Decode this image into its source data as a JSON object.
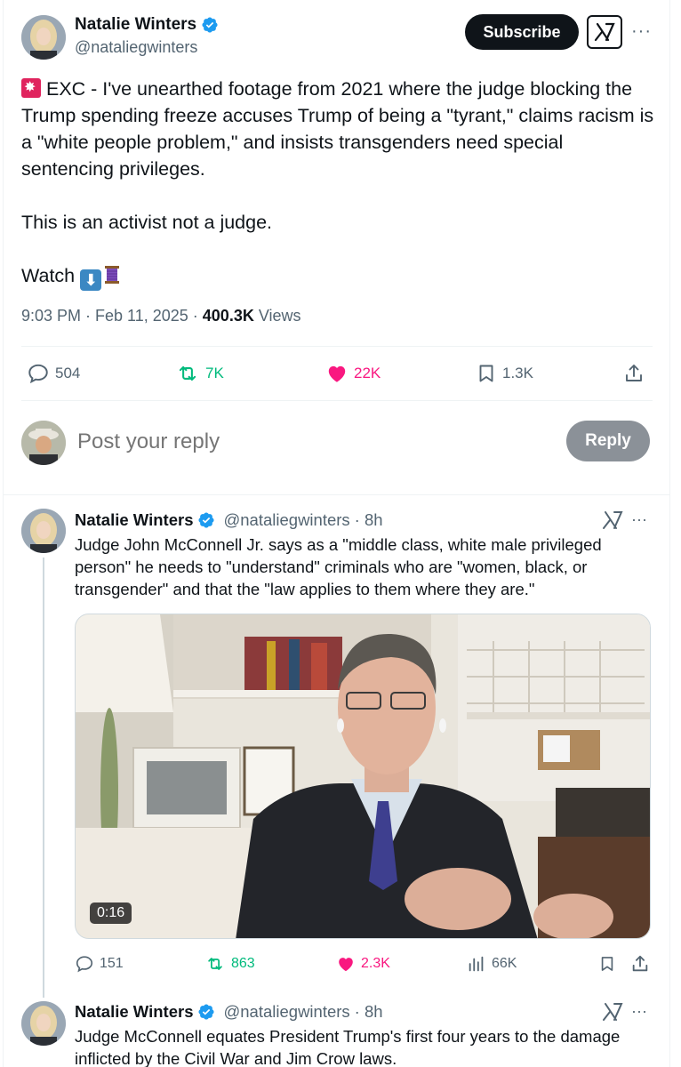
{
  "main_tweet": {
    "author_name": "Natalie Winters",
    "author_handle": "@nataliegwinters",
    "subscribe_label": "Subscribe",
    "more_label": "···",
    "paragraph1": " EXC - I've unearthed footage from 2021 where the  judge blocking the Trump spending freeze accuses Trump of being a \"tyrant,\" claims racism is a \"white people problem,\" and insists transgenders need special sentencing privileges.",
    "paragraph2": "This is an activist not a judge.",
    "paragraph3": "Watch ",
    "time": "9:03 PM · Feb 11, 2025 · ",
    "views_count": "400.3K",
    "views_label": " Views",
    "actions": {
      "replies": "504",
      "reposts": "7K",
      "likes": "22K",
      "bookmarks": "1.3K"
    },
    "colors": {
      "repost": "#00ba7c",
      "like": "#f91880",
      "verified": "#1d9bf0"
    }
  },
  "reply_box": {
    "placeholder": "Post your reply",
    "reply_label": "Reply"
  },
  "thread": [
    {
      "author_name": "Natalie Winters",
      "author_handle": "@nataliegwinters",
      "age": " · 8h",
      "more_label": "···",
      "text": "Judge John McConnell Jr. says as a \"middle class, white male privileged person\" he needs to \"understand\" criminals who are \"women, black, or transgender\" and that the \"law applies to them where they are.\"",
      "video_duration": "0:16",
      "actions": {
        "replies": "151",
        "reposts": "863",
        "likes": "2.3K",
        "views": "66K"
      }
    },
    {
      "author_name": "Natalie Winters",
      "author_handle": "@nataliegwinters",
      "age": " · 8h",
      "more_label": "···",
      "text": "Judge McConnell equates President Trump's first four years to the damage inflicted by the Civil War and Jim Crow laws."
    }
  ]
}
